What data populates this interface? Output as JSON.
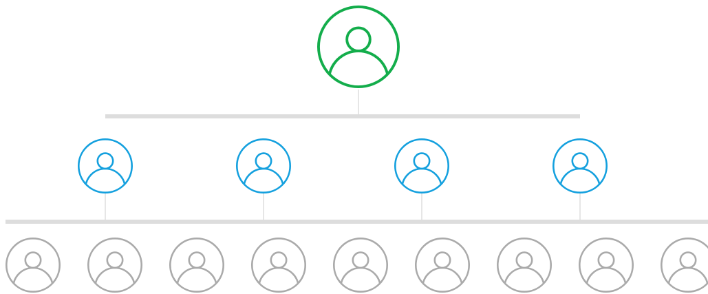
{
  "colors": {
    "background": "#ffffff",
    "top_level": "#13ad4b",
    "middle_level": "#14a0de",
    "bottom_level": "#aaaaaa",
    "connector": "#dddddd"
  },
  "levels": [
    {
      "name": "top",
      "count": 1,
      "icon": "user-icon",
      "color_key": "top_level"
    },
    {
      "name": "middle",
      "count": 4,
      "icon": "user-icon",
      "color_key": "middle_level"
    },
    {
      "name": "bottom",
      "count": 9,
      "icon": "user-icon",
      "color_key": "bottom_level"
    }
  ]
}
